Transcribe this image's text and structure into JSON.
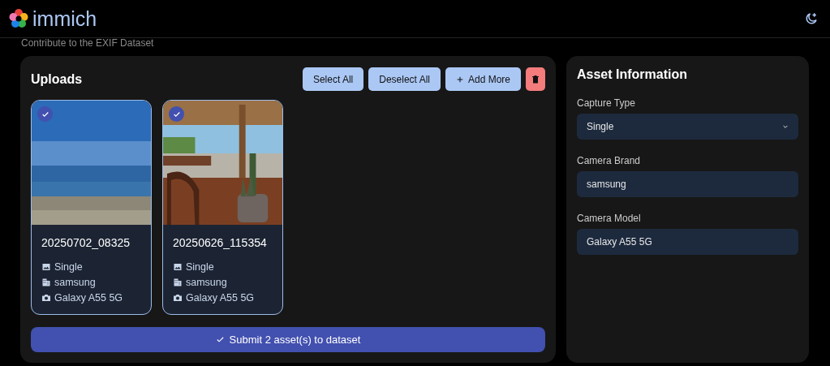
{
  "header": {
    "logo_text": "immich"
  },
  "subtitle": "Contribute to the EXIF Dataset",
  "uploads": {
    "title": "Uploads",
    "buttons": [
      {
        "kind": "select",
        "label": "Select All"
      },
      {
        "kind": "deselect",
        "label": "Deselect All"
      },
      {
        "kind": "add",
        "label": "Add More"
      },
      {
        "kind": "delete"
      }
    ],
    "assets": [
      {
        "filename": "20250702_08325",
        "selected": true,
        "capture_type": "Single",
        "brand": "samsung",
        "model": "Galaxy A55 5G"
      },
      {
        "filename": "20250626_115354",
        "selected": true,
        "capture_type": "Single",
        "brand": "samsung",
        "model": "Galaxy A55 5G"
      }
    ],
    "submit": "Submit 2 asset(s) to dataset"
  },
  "asset_information": {
    "title": "Asset Information",
    "fields": [
      {
        "kind": "select",
        "label": "Capture Type",
        "value": "Single"
      },
      {
        "kind": "text",
        "label": "Camera Brand",
        "value": "samsung"
      },
      {
        "kind": "text",
        "label": "Camera Model",
        "value": "Galaxy A55 5G"
      }
    ]
  }
}
